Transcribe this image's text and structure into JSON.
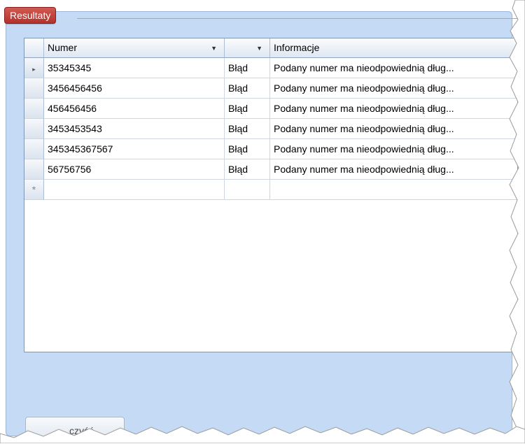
{
  "group": {
    "title": "Resultaty"
  },
  "grid": {
    "columns": [
      {
        "label": "Numer"
      },
      {
        "label": ""
      },
      {
        "label": "Informacje"
      }
    ],
    "rows": [
      {
        "numer": "35345345",
        "status": "Błąd",
        "info": "Podany numer ma nieodpowiednią dług..."
      },
      {
        "numer": "3456456456",
        "status": "Błąd",
        "info": "Podany numer ma nieodpowiednią dług..."
      },
      {
        "numer": "456456456",
        "status": "Błąd",
        "info": "Podany numer ma nieodpowiednią dług..."
      },
      {
        "numer": "3453453543",
        "status": "Błąd",
        "info": "Podany numer ma nieodpowiednią dług..."
      },
      {
        "numer": "345345367567",
        "status": "Błąd",
        "info": "Podany numer ma nieodpowiednią dług..."
      },
      {
        "numer": "56756756",
        "status": "Błąd",
        "info": "Podany numer ma nieodpowiednią dług..."
      }
    ],
    "new_row_marker": "*",
    "current_row_marker": "▸"
  },
  "bottom_button": {
    "label": "czyść"
  },
  "colors": {
    "panel_bg": "#c4daf5",
    "badge_bg": "#b4322c"
  },
  "icons": {
    "dropdown": "chevron-down-icon",
    "current_row": "row-pointer-icon",
    "new_row": "asterisk-icon"
  }
}
